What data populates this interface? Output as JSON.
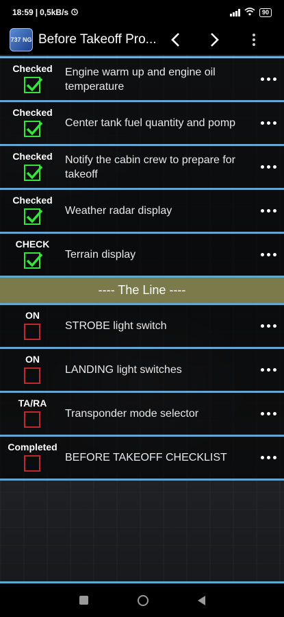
{
  "status_bar": {
    "time": "18:59",
    "network_speed": "0,5kB/s",
    "battery": "90",
    "icons": [
      "alarm-icon",
      "signal-icon",
      "wifi-icon",
      "battery-icon"
    ]
  },
  "app_bar": {
    "logo_text": "737 NG",
    "title": "Before Takeoff Pro...",
    "prev_icon": "‹",
    "next_icon": "›"
  },
  "colors": {
    "checked": "#35e43a",
    "unchecked": "#c02a2a",
    "separator": "#5fa8d0",
    "divider_bg": "#7a7a4a"
  },
  "checklist": {
    "items_before_line": [
      {
        "status": "Checked",
        "text": "Engine warm up and engine oil temperature",
        "checked": true
      },
      {
        "status": "Checked",
        "text": "Center tank fuel quantity and pomp",
        "checked": true
      },
      {
        "status": "Checked",
        "text": "Notify the cabin crew to prepare for takeoff",
        "checked": true
      },
      {
        "status": "Checked",
        "text": "Weather radar display",
        "checked": true
      },
      {
        "status": "CHECK",
        "text": "Terrain display",
        "checked": true
      }
    ],
    "divider_label": "---- The Line ----",
    "items_after_line": [
      {
        "status": "ON",
        "text": "STROBE light switch",
        "checked": false
      },
      {
        "status": "ON",
        "text": "LANDING light switches",
        "checked": false
      },
      {
        "status": "TA/RA",
        "text": "Transponder mode selector",
        "checked": false
      },
      {
        "status": "Completed",
        "text": "BEFORE TAKEOFF CHECKLIST",
        "checked": false
      }
    ]
  }
}
